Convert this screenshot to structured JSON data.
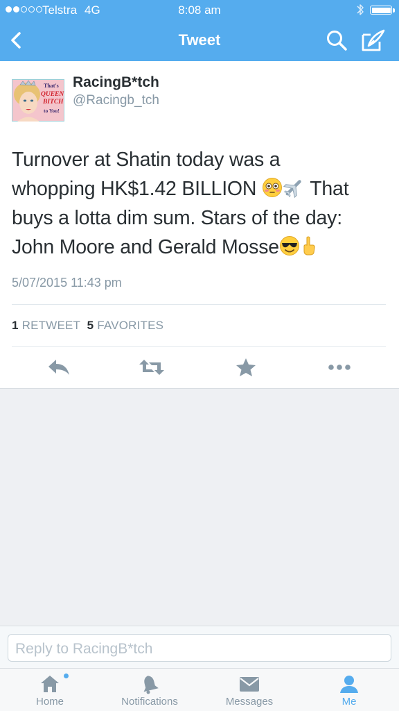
{
  "status_bar": {
    "carrier": "Telstra",
    "network": "4G",
    "time": "8:08 am",
    "signal_bars_filled": 2,
    "signal_bars_total": 5
  },
  "nav": {
    "title": "Tweet"
  },
  "tweet": {
    "display_name": "RacingB*tch",
    "handle": "@Racingb_tch",
    "avatar_text": [
      "That's",
      "QUEEN",
      "BITCH",
      "to You!"
    ],
    "text_lines": [
      {
        "a": "Turnover at Shatin today was a",
        "b": ""
      },
      {
        "a": "whopping HK$1.42 BILLION ",
        "b": " That"
      },
      {
        "a": "buys a lotta dim sum. Stars of the day:",
        "b": ""
      },
      {
        "a": "John Moore and Gerald Mosse",
        "b": ""
      }
    ],
    "timestamp": "5/07/2015 11:43 pm",
    "retweets_count": "1",
    "retweets_label": "RETWEET",
    "favorites_count": "5",
    "favorites_label": "FAVORITES"
  },
  "reply": {
    "placeholder": "Reply to RacingB*tch"
  },
  "tabbar": {
    "home": "Home",
    "notifications": "Notifications",
    "messages": "Messages",
    "me": "Me"
  },
  "colors": {
    "brand": "#55acee",
    "text": "#292f33",
    "secondary": "#8899a6"
  },
  "icons": [
    "back-icon",
    "search-icon",
    "compose-icon",
    "reply-icon",
    "retweet-icon",
    "favorite-icon",
    "more-icon",
    "home-icon",
    "notifications-icon",
    "messages-icon",
    "me-icon",
    "flushed-face-emoji",
    "airplane-emoji",
    "sunglasses-face-emoji",
    "pointing-up-emoji"
  ]
}
